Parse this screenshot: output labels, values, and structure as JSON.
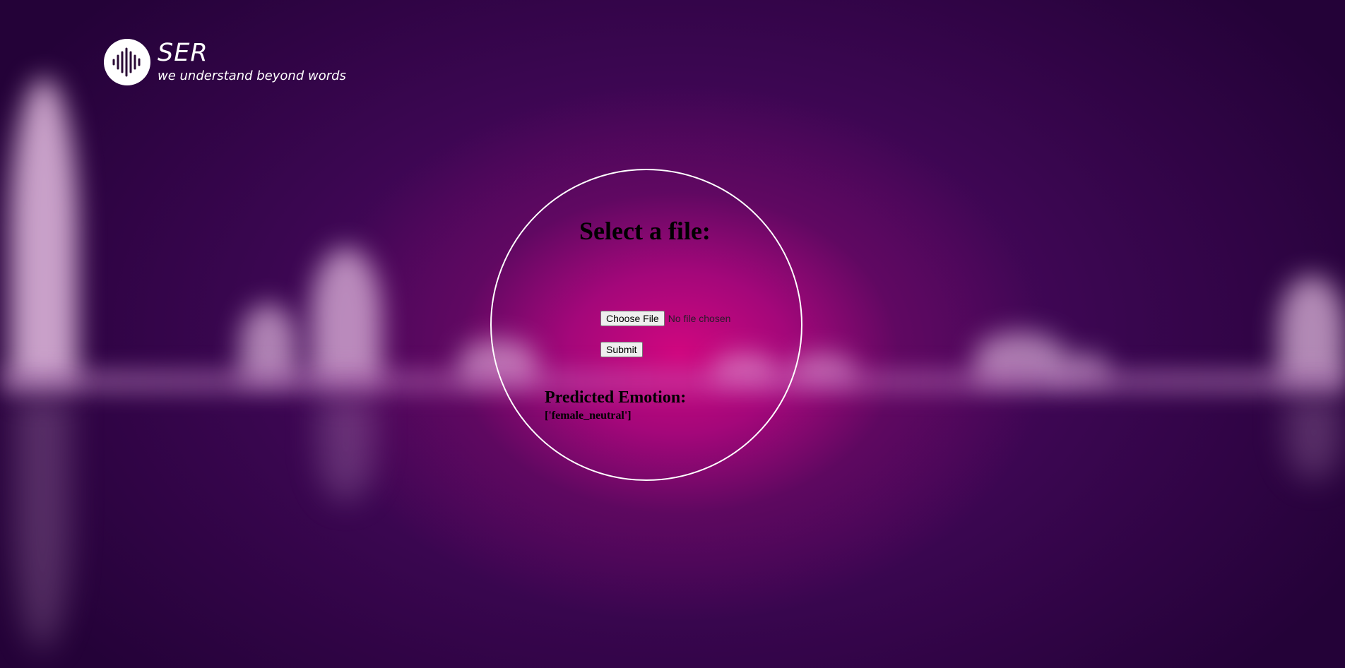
{
  "brand": {
    "logo_icon": "waveform-icon",
    "title": "SER",
    "tagline": "we understand beyond words"
  },
  "form": {
    "title": "Select a file:",
    "choose_file_label": "Choose File",
    "file_status": "No file chosen",
    "submit_label": "Submit"
  },
  "result": {
    "heading": "Predicted Emotion:",
    "value": "['female_neutral']"
  },
  "colors": {
    "background_dark": "#240238",
    "background_glow": "#d0077f",
    "circle_border": "#ffffff"
  }
}
